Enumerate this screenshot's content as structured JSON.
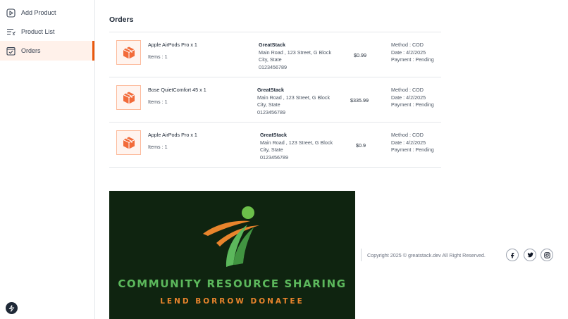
{
  "sidebar": {
    "items": [
      {
        "label": "Add Product",
        "icon": "add-box-icon",
        "active": false
      },
      {
        "label": "Product List",
        "icon": "list-icon",
        "active": false
      },
      {
        "label": "Orders",
        "icon": "checklist-icon",
        "active": true
      }
    ]
  },
  "main": {
    "title": "Orders",
    "orders": [
      {
        "product": "Apple AirPods Pro x 1",
        "items": "Items : 1",
        "customer": "GreatStack",
        "address_line1": "Main Road , 123 Street, G Block",
        "address_line2": "City, State",
        "phone": "0123456789",
        "amount": "$0.99",
        "method": "Method : COD",
        "date": "Date : 4/2/2025",
        "payment": "Payment : Pending"
      },
      {
        "product": "Bose QuietComfort 45 x 1",
        "items": "Items : 1",
        "customer": "GreatStack",
        "address_line1": "Main Road , 123 Street, G Block",
        "address_line2": "City, State",
        "phone": "0123456789",
        "amount": "$335.99",
        "method": "Method : COD",
        "date": "Date : 4/2/2025",
        "payment": "Payment : Pending"
      },
      {
        "product": "Apple AirPods Pro x 1",
        "items": "Items : 1",
        "customer": "GreatStack",
        "address_line1": "Main Road , 123 Street, G Block",
        "address_line2": "City, State",
        "phone": "0123456789",
        "amount": "$0.9",
        "method": "Method : COD",
        "date": "Date : 4/2/2025",
        "payment": "Payment : Pending"
      }
    ]
  },
  "banner": {
    "headline": "COMMUNITY RESOURCE SHARING",
    "tagline": "LEND BORROW DONATEE"
  },
  "footer": {
    "copyright": "Copyright 2025 © greatstack.dev All Right Reserved.",
    "social": [
      "facebook-icon",
      "twitter-icon",
      "instagram-icon"
    ]
  },
  "colors": {
    "accent": "#ea580c",
    "active_bg": "#fff1ea",
    "banner_bg": "#0f2410",
    "banner_green": "#5cb85c",
    "banner_orange": "#e8842c"
  }
}
